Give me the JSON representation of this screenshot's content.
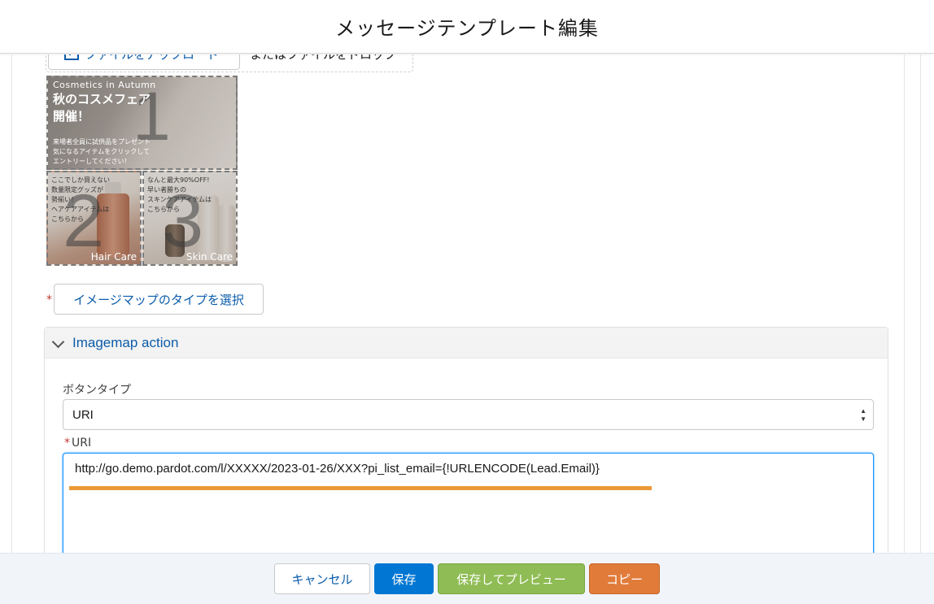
{
  "header": {
    "title": "メッセージテンプレート編集"
  },
  "upload": {
    "button_label": "ファイルをアップロード",
    "drop_text": "またはファイルをドロップ"
  },
  "imagemap": {
    "cell1": {
      "subtitle_en": "Cosmetics in Autumn",
      "title_line1": "秋のコスメフェア",
      "title_line2": "開催！",
      "desc_line1": "来場者全員に試供品をプレゼント",
      "desc_line2": "気になるアイテムをクリックして",
      "desc_line3": "エントリーしてください！",
      "number": "1"
    },
    "cell2": {
      "text_line1": "ここでしか買えない",
      "text_line2": "数量限定グッズが",
      "text_line3": "勢揃い！",
      "text_line4": "ヘアケアアイテムは",
      "text_line5": "こちらから",
      "number": "2",
      "label": "Hair Care"
    },
    "cell3": {
      "text_line1": "なんと最大90%OFF!",
      "text_line2": "早い者勝ちの",
      "text_line3": "スキンケアアイテムは",
      "text_line4": "こちらから",
      "number": "3",
      "label": "Skin Care"
    }
  },
  "imagemap_type": {
    "required_mark": "*",
    "button_label": "イメージマップのタイプを選択"
  },
  "action_section": {
    "title": "Imagemap action",
    "button_type_label": "ボタンタイプ",
    "button_type_value": "URI",
    "uri_label": "URI",
    "uri_required_mark": "*",
    "uri_value": "http://go.demo.pardot.com/l/XXXXX/2023-01-26/XXX?pi_list_email={!URLENCODE(Lead.Email)}"
  },
  "footer": {
    "cancel_label": "キャンセル",
    "save_label": "保存",
    "save_preview_label": "保存してプレビュー",
    "copy_label": "コピー"
  },
  "colors": {
    "link_blue": "#0b5cab",
    "primary_blue": "#0176d3",
    "preview_green": "#8fbc54",
    "copy_orange": "#e17b3a",
    "highlight_orange": "#ea9a3a",
    "required_red": "#c23934"
  }
}
